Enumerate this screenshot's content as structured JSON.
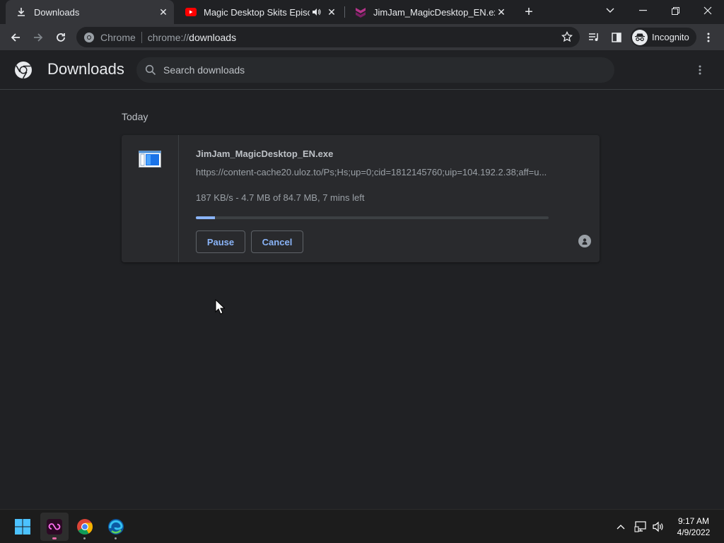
{
  "tabs": [
    {
      "title": "Downloads",
      "icon": "download-icon",
      "active": true
    },
    {
      "title": "Magic Desktop Skits Episode",
      "icon": "youtube-icon",
      "active": false
    },
    {
      "title": "JimJam_MagicDesktop_EN.exe | U",
      "icon": "uloz-icon",
      "active": false
    }
  ],
  "toolbar": {
    "omnibox_site": "Chrome",
    "omnibox_scheme": "chrome://",
    "omnibox_path": "downloads",
    "incognito_label": "Incognito"
  },
  "page": {
    "title": "Downloads",
    "search_placeholder": "Search downloads"
  },
  "section": {
    "date_label": "Today"
  },
  "download": {
    "file_name": "JimJam_MagicDesktop_EN.exe",
    "url": "https://content-cache20.uloz.to/Ps;Hs;up=0;cid=1812145760;uip=104.192.2.38;aff=u...",
    "status": "187 KB/s - 4.7 MB of 84.7 MB, 7 mins left",
    "progress_percent": 5.5,
    "pause_label": "Pause",
    "cancel_label": "Cancel"
  },
  "taskbar": {
    "time": "9:17 AM",
    "date": "4/9/2022"
  },
  "colors": {
    "accent": "#8ab4f8",
    "background": "#202124",
    "card": "#292a2d"
  }
}
